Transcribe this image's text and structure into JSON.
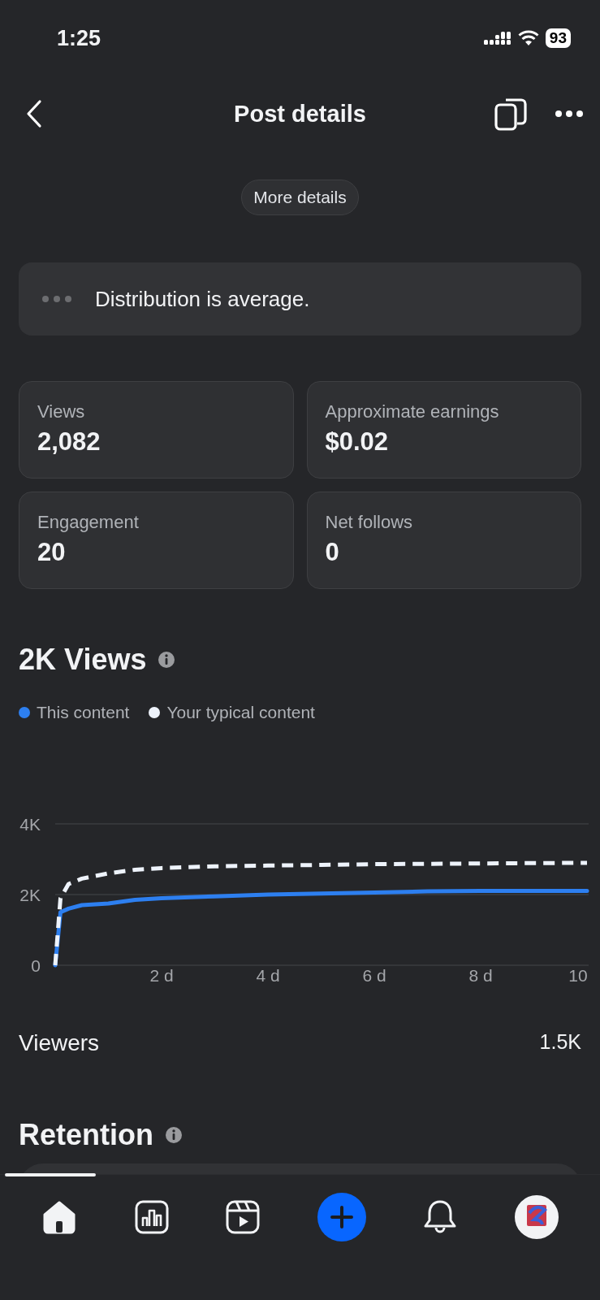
{
  "status_bar": {
    "time": "1:25",
    "battery": "93"
  },
  "header": {
    "title": "Post details"
  },
  "more_details_button": "More details",
  "distribution": {
    "text": "Distribution is average."
  },
  "stats": [
    {
      "label": "Views",
      "value": "2,082"
    },
    {
      "label": "Approximate earnings",
      "value": "$0.02"
    },
    {
      "label": "Engagement",
      "value": "20"
    },
    {
      "label": "Net follows",
      "value": "0"
    }
  ],
  "views_section": {
    "title": "2K Views",
    "chart_data": {
      "type": "line",
      "x": [
        0,
        0.1,
        0.25,
        0.5,
        1,
        1.5,
        2,
        3,
        4,
        5,
        6,
        7,
        8,
        9,
        10
      ],
      "xlim": [
        0,
        10
      ],
      "ylim": [
        0,
        4000
      ],
      "xticks": [
        {
          "value": 2,
          "label": "2 d"
        },
        {
          "value": 4,
          "label": "4 d"
        },
        {
          "value": 6,
          "label": "6 d"
        },
        {
          "value": 8,
          "label": "8 d"
        },
        {
          "value": 10,
          "label": "10"
        }
      ],
      "yticks": [
        {
          "value": 0,
          "label": "0"
        },
        {
          "value": 2000,
          "label": "2K"
        },
        {
          "value": 4000,
          "label": "4K"
        }
      ],
      "series": [
        {
          "name": "This content",
          "color": "#2d7ff0",
          "line_style": "solid",
          "values": [
            0,
            1500,
            1600,
            1700,
            1750,
            1850,
            1900,
            1950,
            2000,
            2030,
            2060,
            2090,
            2100,
            2100,
            2100
          ]
        },
        {
          "name": "Your typical content",
          "color": "#eef3fb",
          "line_style": "dashed",
          "values": [
            0,
            1900,
            2300,
            2450,
            2600,
            2700,
            2750,
            2800,
            2820,
            2840,
            2860,
            2870,
            2880,
            2890,
            2900
          ]
        }
      ]
    }
  },
  "viewers": {
    "label": "Viewers",
    "value": "1.5K"
  },
  "retention": {
    "title": "Retention"
  },
  "nav": [
    {
      "kind": "home",
      "selected": true
    },
    {
      "kind": "insights",
      "selected": false
    },
    {
      "kind": "reels",
      "selected": false
    },
    {
      "kind": "create",
      "selected": false
    },
    {
      "kind": "notifications",
      "selected": false
    },
    {
      "kind": "profile",
      "selected": false
    }
  ]
}
